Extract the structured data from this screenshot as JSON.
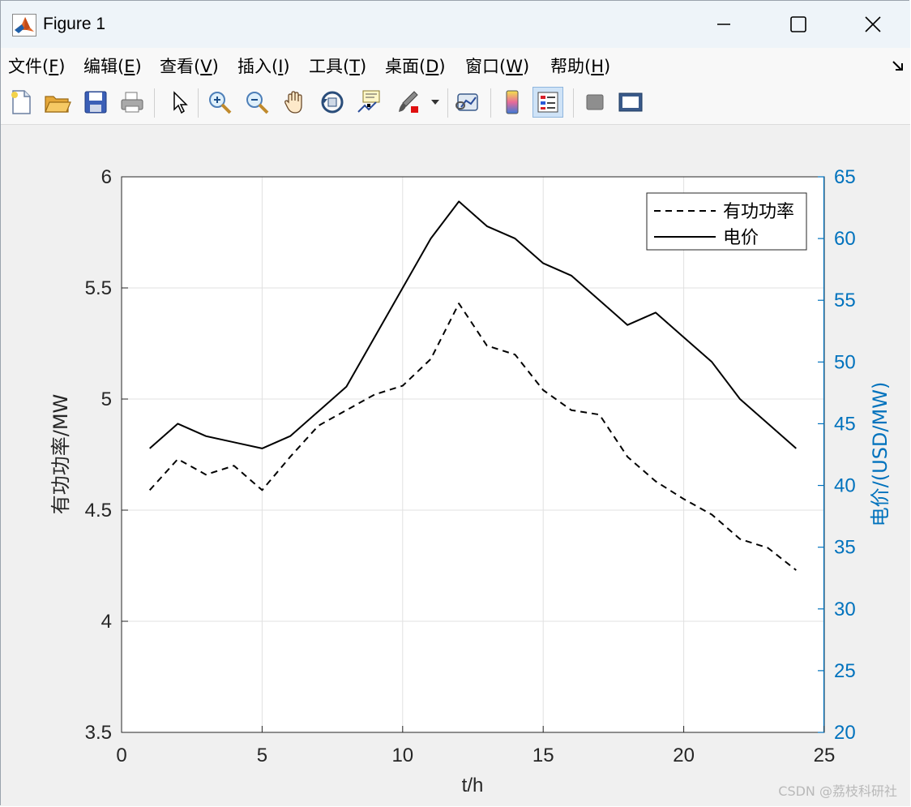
{
  "window": {
    "title": "Figure 1"
  },
  "menu": {
    "items": [
      {
        "label": "文件(",
        "key": "F",
        "end": ")"
      },
      {
        "label": "编辑(",
        "key": "E",
        "end": ")"
      },
      {
        "label": "查看(",
        "key": "V",
        "end": ")"
      },
      {
        "label": "插入(",
        "key": "I",
        "end": ")"
      },
      {
        "label": "工具(",
        "key": "T",
        "end": ")"
      },
      {
        "label": "桌面(",
        "key": "D",
        "end": ")"
      },
      {
        "label": "窗口(",
        "key": "W",
        "end": ")"
      },
      {
        "label": "帮助(",
        "key": "H",
        "end": ")"
      }
    ]
  },
  "toolbar": {
    "buttons": [
      "new-file-icon",
      "open-folder-icon",
      "save-icon",
      "print-icon",
      "pointer-icon",
      "zoom-in-icon",
      "zoom-out-icon",
      "pan-hand-icon",
      "rotate-3d-icon",
      "data-cursor-icon",
      "brush-icon",
      "link-plot-icon",
      "colorbar-icon",
      "legend-icon",
      "hide-plot-tools-icon",
      "show-plot-tools-icon"
    ],
    "active": "legend-icon"
  },
  "watermark": "CSDN @荔枝科研社",
  "chart_data": {
    "type": "line",
    "title": "",
    "xlabel": "t/h",
    "ylabel_left": "有功功率/MW",
    "ylabel_right": "电价/(USD/MW)",
    "xlim": [
      0,
      25
    ],
    "ylim_left": [
      3.5,
      6
    ],
    "ylim_right": [
      20,
      65
    ],
    "xticks": [
      "0",
      "5",
      "10",
      "15",
      "20",
      "25"
    ],
    "yticks_left": [
      "3.5",
      "4",
      "4.5",
      "5",
      "5.5",
      "6"
    ],
    "yticks_right": [
      "20",
      "25",
      "30",
      "35",
      "40",
      "45",
      "50",
      "55",
      "60",
      "65"
    ],
    "grid": true,
    "legend_position": "top-right",
    "colors": {
      "left_axis": "#000000",
      "right_axis": "#0072bd",
      "grid": "#e1e1e1"
    },
    "x": [
      1,
      2,
      3,
      4,
      5,
      6,
      7,
      8,
      9,
      10,
      11,
      12,
      13,
      14,
      15,
      16,
      17,
      18,
      19,
      20,
      21,
      22,
      23,
      24
    ],
    "series": [
      {
        "name": "有功功率",
        "axis": "left",
        "style": "dashed",
        "values": [
          4.59,
          4.73,
          4.66,
          4.7,
          4.59,
          4.74,
          4.88,
          4.95,
          5.02,
          5.06,
          5.18,
          5.43,
          5.24,
          5.2,
          5.04,
          4.95,
          4.93,
          4.74,
          4.63,
          4.55,
          4.48,
          4.37,
          4.33,
          4.23
        ]
      },
      {
        "name": "电价",
        "axis": "right",
        "style": "solid",
        "values": [
          43,
          45,
          44,
          43.5,
          43,
          44,
          46,
          48,
          52,
          56,
          60,
          63,
          61,
          60,
          58,
          57,
          55,
          53,
          54,
          52,
          50,
          47,
          45,
          43
        ]
      }
    ]
  }
}
